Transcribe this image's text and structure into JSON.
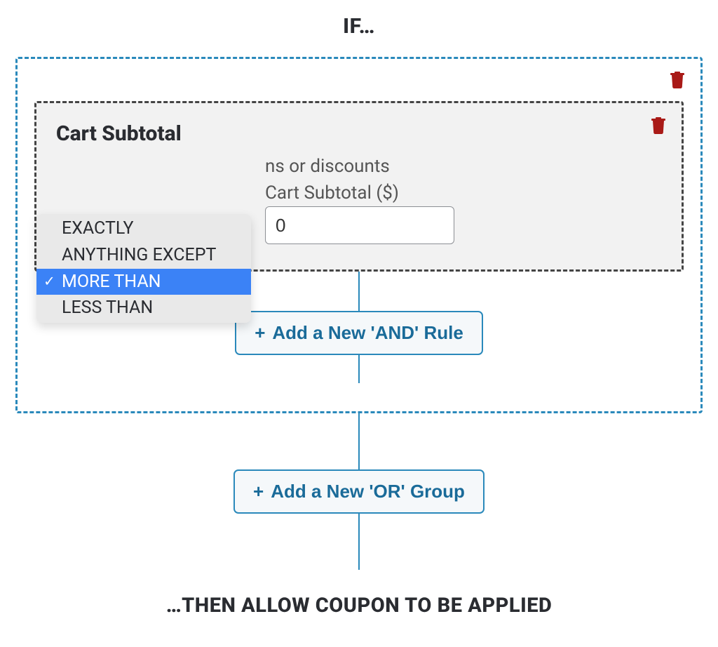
{
  "heading_if": "IF…",
  "heading_then": "…THEN ALLOW COUPON TO BE APPLIED",
  "rule": {
    "title": "Cart Subtotal",
    "obscured_text_fragment": "ns or discounts",
    "value_label": "Cart Subtotal ($)",
    "value": "0",
    "operator_selected": "MORE THAN",
    "operator_options": [
      "EXACTLY",
      "ANYTHING EXCEPT",
      "MORE THAN",
      "LESS THAN"
    ]
  },
  "buttons": {
    "add_and": "Add a New 'AND' Rule",
    "add_or": "Add a New 'OR' Group"
  }
}
